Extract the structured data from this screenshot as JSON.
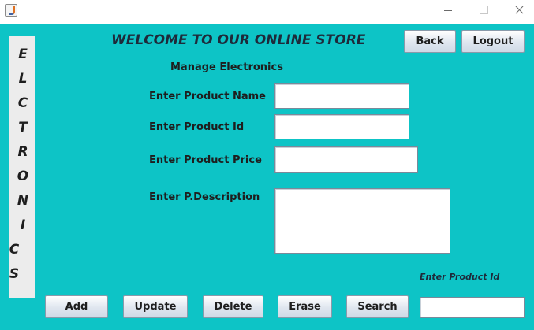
{
  "window": {
    "app_icon": "java-cup-icon",
    "controls": {
      "minimize": "minimize-icon",
      "maximize": "maximize-icon",
      "close": "close-icon"
    }
  },
  "sidebar": {
    "letters": [
      "E",
      "L",
      "C",
      "T",
      "R",
      "O",
      "N",
      "I",
      "C",
      "S"
    ]
  },
  "header": {
    "title": "WELCOME TO OUR ONLINE STORE",
    "subtitle": "Manage Electronics",
    "back_label": "Back",
    "logout_label": "Logout"
  },
  "form": {
    "product_name_label": "Enter Product Name",
    "product_name_value": "",
    "product_id_label": "Enter Product Id",
    "product_id_value": "",
    "product_price_label": "Enter Product Price",
    "product_price_value": "",
    "description_label": "Enter P.Description",
    "description_value": ""
  },
  "actions": {
    "add_label": "Add",
    "update_label": "Update",
    "delete_label": "Delete",
    "erase_label": "Erase",
    "search_label": "Search"
  },
  "search": {
    "label": "Enter Product Id",
    "value": ""
  },
  "colors": {
    "background": "#0dc4c6",
    "sidebar": "#ececec",
    "titlebar": "#ffffff"
  }
}
